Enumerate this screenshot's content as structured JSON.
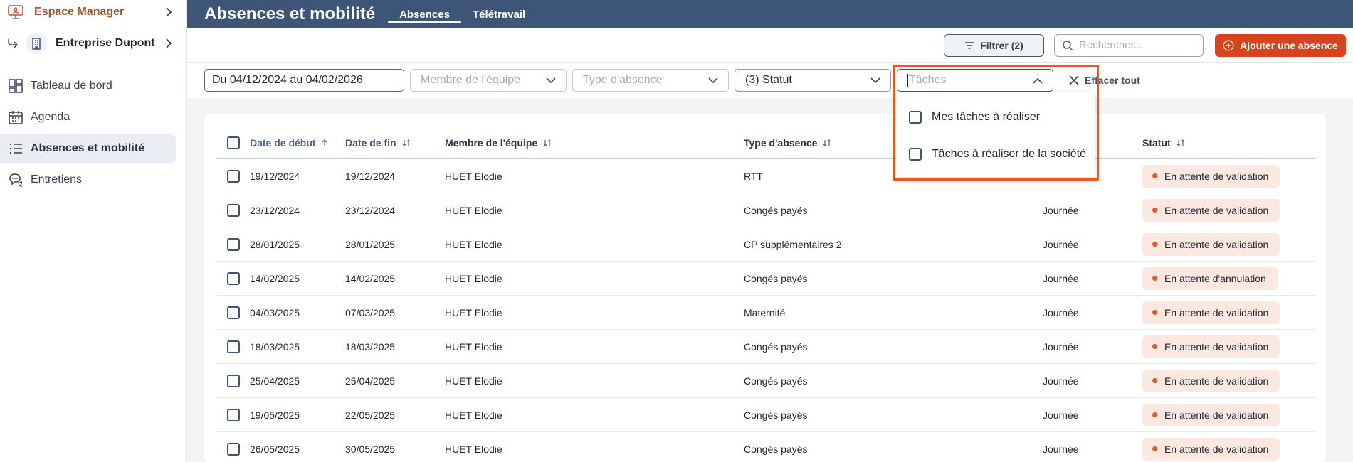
{
  "sidebar": {
    "space_label": "Espace Manager",
    "company_label": "Entreprise Dupont",
    "items": [
      {
        "label": "Tableau de bord",
        "icon": "dashboard-icon"
      },
      {
        "label": "Agenda",
        "icon": "calendar-icon"
      },
      {
        "label": "Absences et mobilité",
        "icon": "list-icon",
        "active": true
      },
      {
        "label": "Entretiens",
        "icon": "chat-icon"
      }
    ]
  },
  "header": {
    "title": "Absences et mobilité",
    "tabs": [
      {
        "label": "Absences",
        "active": true
      },
      {
        "label": "Télétravail",
        "active": false
      }
    ]
  },
  "toolbar": {
    "filter_label": "Filtrer (2)",
    "search_placeholder": "Rechercher...",
    "add_label": "Ajouter une absence"
  },
  "filters": {
    "date_range": "Du 04/12/2024 au 04/02/2026",
    "member_placeholder": "Membre de l'équipe",
    "type_placeholder": "Type d'absence",
    "status_value": "(3) Statut",
    "taches_placeholder": "Tâches",
    "clear_all": "Effacer tout"
  },
  "taches_dropdown": {
    "options": [
      "Mes tâches à réaliser",
      "Tâches à réaliser de la société"
    ]
  },
  "table": {
    "headers": {
      "start": "Date de début",
      "end": "Date de fin",
      "member": "Membre de l'équipe",
      "type": "Type d'absence",
      "status": "Statut"
    },
    "rows": [
      {
        "start": "19/12/2024",
        "end": "19/12/2024",
        "member": "HUET Elodie",
        "type": "RTT",
        "duration": "",
        "status": "En attente de validation"
      },
      {
        "start": "23/12/2024",
        "end": "23/12/2024",
        "member": "HUET Elodie",
        "type": "Congés payés",
        "duration": "Journée",
        "status": "En attente de validation"
      },
      {
        "start": "28/01/2025",
        "end": "28/01/2025",
        "member": "HUET Elodie",
        "type": "CP supplémentaires 2",
        "duration": "Journée",
        "status": "En attente de validation"
      },
      {
        "start": "14/02/2025",
        "end": "14/02/2025",
        "member": "HUET Elodie",
        "type": "Congés payés",
        "duration": "Journée",
        "status": "En attente d'annulation"
      },
      {
        "start": "04/03/2025",
        "end": "07/03/2025",
        "member": "HUET Elodie",
        "type": "Maternité",
        "duration": "Journée",
        "status": "En attente de validation"
      },
      {
        "start": "18/03/2025",
        "end": "18/03/2025",
        "member": "HUET Elodie",
        "type": "Congés payés",
        "duration": "Journée",
        "status": "En attente de validation"
      },
      {
        "start": "25/04/2025",
        "end": "25/04/2025",
        "member": "HUET Elodie",
        "type": "Congés payés",
        "duration": "Journée",
        "status": "En attente de validation"
      },
      {
        "start": "19/05/2025",
        "end": "22/05/2025",
        "member": "HUET Elodie",
        "type": "Congés payés",
        "duration": "Journée",
        "status": "En attente de validation"
      },
      {
        "start": "26/05/2025",
        "end": "30/05/2025",
        "member": "HUET Elodie",
        "type": "Congés payés",
        "duration": "Journée",
        "status": "En attente de validation"
      }
    ]
  },
  "colors": {
    "header_bg": "#3d5677",
    "accent": "#d8431d",
    "badge_bg": "#fbe9e1",
    "badge_dot": "#e55a1f",
    "highlight": "#ea5b1a"
  }
}
